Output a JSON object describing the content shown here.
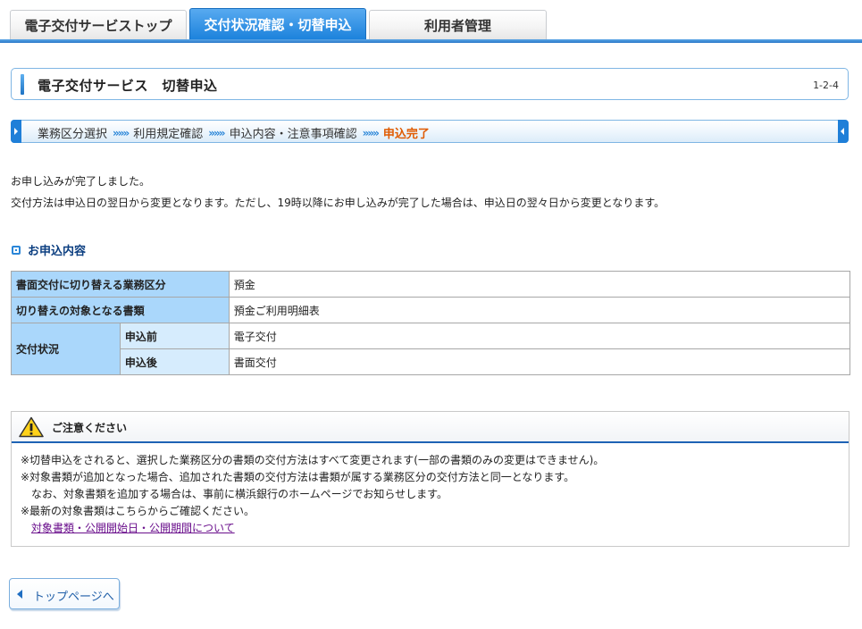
{
  "tabs": [
    {
      "label": "電子交付サービストップ",
      "active": false
    },
    {
      "label": "交付状況確認・切替申込",
      "active": true
    },
    {
      "label": "利用者管理",
      "active": false
    }
  ],
  "title": {
    "text": "電子交付サービス　切替申込",
    "code": "1-2-4"
  },
  "steps": {
    "items": [
      "業務区分選択",
      "利用規定確認",
      "申込内容・注意事項確認"
    ],
    "current": "申込完了",
    "separator": "»»»"
  },
  "messages": {
    "line1": "お申し込みが完了しました。",
    "line2": "交付方法は申込日の翌日から変更となります。ただし、19時以降にお申し込みが完了した場合は、申込日の翌々日から変更となります。"
  },
  "section": {
    "heading": "お申込内容"
  },
  "table": {
    "row1": {
      "label": "書面交付に切り替える業務区分",
      "value": "預金"
    },
    "row2": {
      "label": "切り替えの対象となる書類",
      "value": "預金ご利用明細表"
    },
    "status": {
      "label": "交付状況",
      "before_label": "申込前",
      "before_value": "電子交付",
      "after_label": "申込後",
      "after_value": "書面交付"
    }
  },
  "notice": {
    "heading": "ご注意ください",
    "line1": "※切替申込をされると、選択した業務区分の書類の交付方法はすべて変更されます(一部の書類のみの変更はできません)。",
    "line2": "※対象書類が追加となった場合、追加された書類の交付方法は書類が属する業務区分の交付方法と同一となります。",
    "line3": "なお、対象書類を追加する場合は、事前に横浜銀行のホームページでお知らせします。",
    "line4": "※最新の対象書類はこちらからご確認ください。",
    "link": "対象書類・公開開始日・公開期間について"
  },
  "back_button": {
    "label": "トップページへ"
  },
  "colors": {
    "accent": "#1f7fd8",
    "current_step": "#e05a00",
    "table_header": "#aad7fb",
    "link": "#6a0f8c"
  }
}
